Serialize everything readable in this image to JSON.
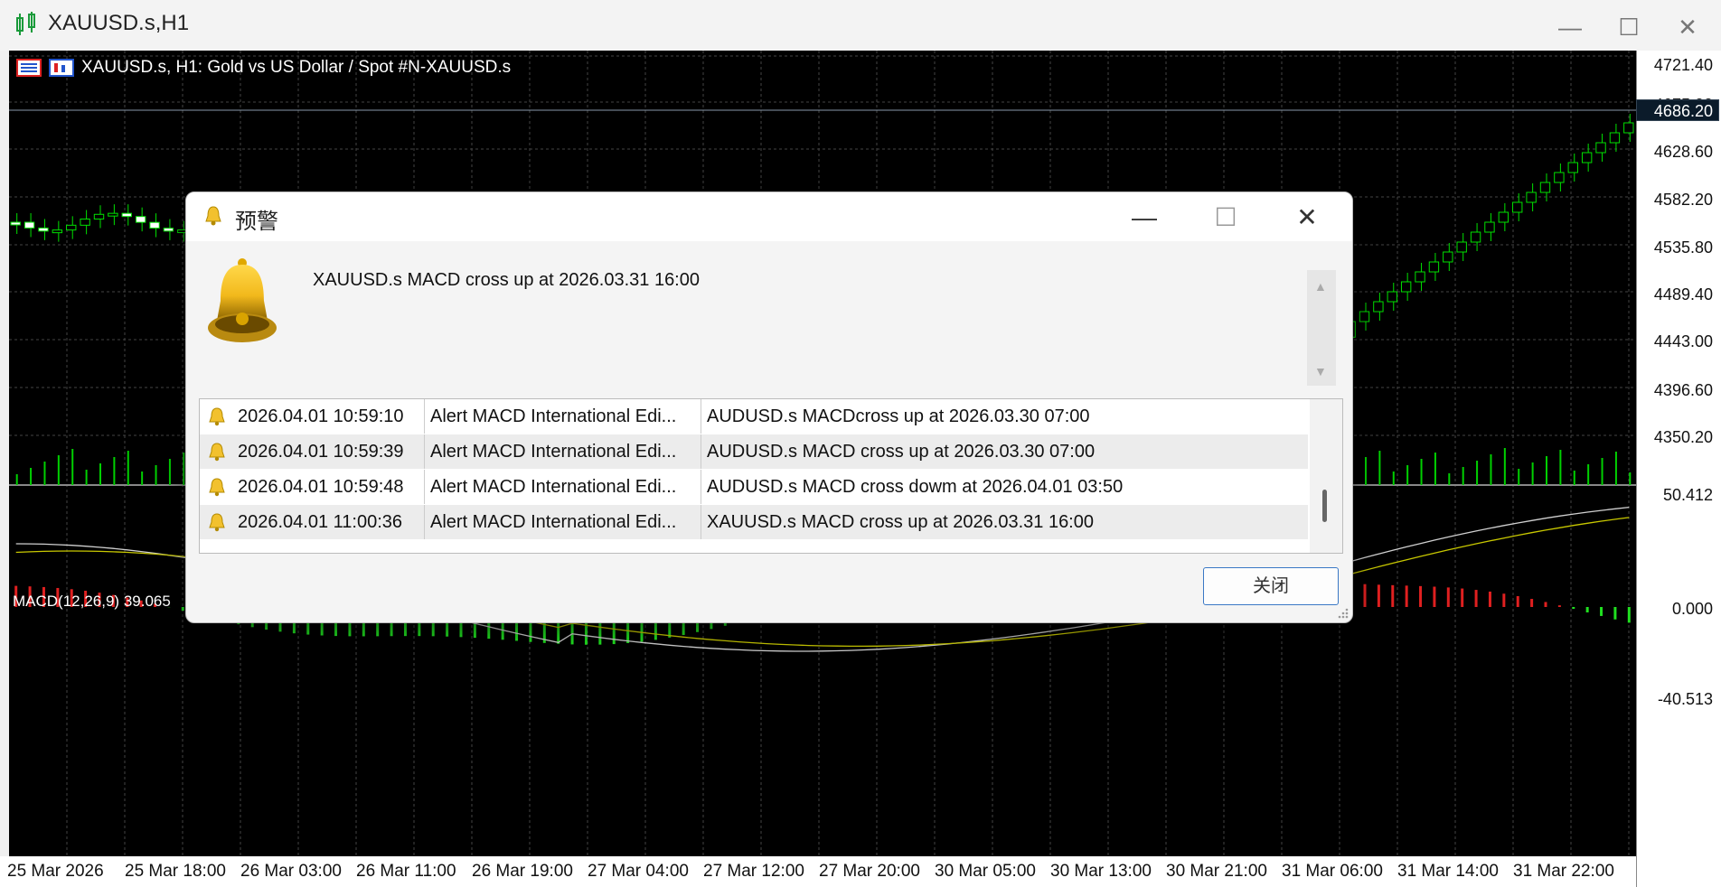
{
  "window": {
    "title": "XAUUSD.s,H1",
    "controls": [
      "minimize-icon",
      "maximize-icon",
      "close-icon"
    ]
  },
  "chart": {
    "header": "XAUUSD.s, H1:  Gold vs US Dollar / Spot #N-XAUUSD.s",
    "current_price": "4686.20",
    "price_labels": [
      "4721.40",
      "4675.00",
      "4628.60",
      "4582.20",
      "4535.80",
      "4489.40",
      "4443.00",
      "4396.60",
      "4350.20"
    ],
    "macd_label": "MACD(12,26,9) 39.065",
    "macd_labels": [
      "50.412",
      "0.000",
      "-40.513"
    ],
    "time_labels": [
      "25 Mar 2026",
      "25 Mar 18:00",
      "26 Mar 03:00",
      "26 Mar 11:00",
      "26 Mar 19:00",
      "27 Mar 04:00",
      "27 Mar 12:00",
      "27 Mar 20:00",
      "30 Mar 05:00",
      "30 Mar 13:00",
      "30 Mar 21:00",
      "31 Mar 06:00",
      "31 Mar 14:00",
      "31 Mar 22:00"
    ],
    "colors": {
      "bull": "#00e000",
      "bear": "#ffffff",
      "hist_pos": "#e02020",
      "hist_neg": "#20e020",
      "signal": "#c8c800",
      "macd": "#d0d0d0"
    }
  },
  "dialog": {
    "title": "预警",
    "message": "XAUUSD.s MACD cross up at 2026.03.31 16:00",
    "close_label": "关闭",
    "rows": [
      {
        "time": "2026.04.01 10:59:10",
        "source": "Alert MACD International Edi...",
        "text": "AUDUSD.s MACDcross up at 2026.03.30 07:00"
      },
      {
        "time": "2026.04.01 10:59:39",
        "source": "Alert MACD International Edi...",
        "text": "AUDUSD.s MACD cross up at 2026.03.30 07:00"
      },
      {
        "time": "2026.04.01 10:59:48",
        "source": "Alert MACD International Edi...",
        "text": "AUDUSD.s MACD cross dowm at 2026.04.01 03:50"
      },
      {
        "time": "2026.04.01 11:00:36",
        "source": "Alert MACD International Edi...",
        "text": "XAUUSD.s MACD cross up at 2026.03.31 16:00"
      }
    ]
  }
}
